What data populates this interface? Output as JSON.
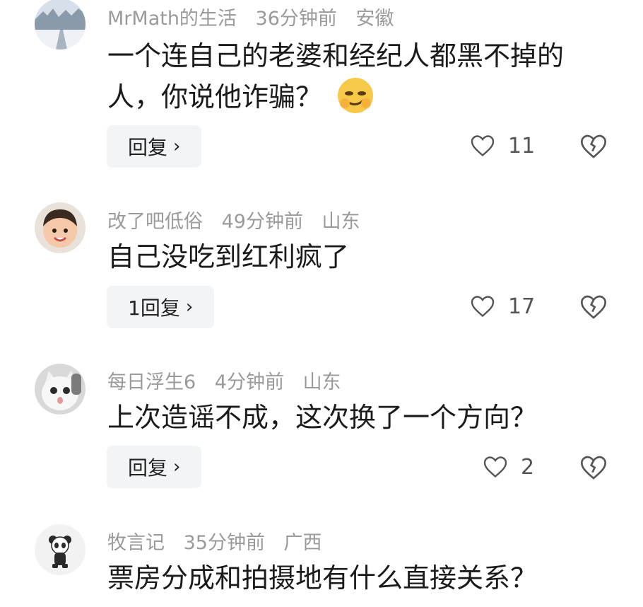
{
  "comments": [
    {
      "username": "MrMath的生活",
      "time": "36分钟前",
      "location": "安徽",
      "text": "一个连自己的老婆和经纪人都黑不掉的人，你说他诈骗？",
      "emoji": "smirk-emoji",
      "reply_label": "回复",
      "likes": "11",
      "avatar": "snowy-road-avatar"
    },
    {
      "username": "改了吧低俗",
      "time": "49分钟前",
      "location": "山东",
      "text": "自己没吃到红利疯了",
      "reply_label": "1回复",
      "likes": "17",
      "avatar": "child-avatar"
    },
    {
      "username": "每日浮生6",
      "time": "4分钟前",
      "location": "山东",
      "text": "上次造谣不成，这次换了一个方向？",
      "reply_label": "回复",
      "likes": "2",
      "avatar": "cat-avatar"
    },
    {
      "username": "牧言记",
      "time": "35分钟前",
      "location": "广西",
      "text": "票房分成和拍摄地有什么直接关系？",
      "avatar": "panda-avatar"
    }
  ],
  "icons": {
    "like": "heart-outline-icon",
    "dislike": "broken-heart-icon",
    "chevron": "chevron-right-icon"
  },
  "chevron_glyph": "›"
}
